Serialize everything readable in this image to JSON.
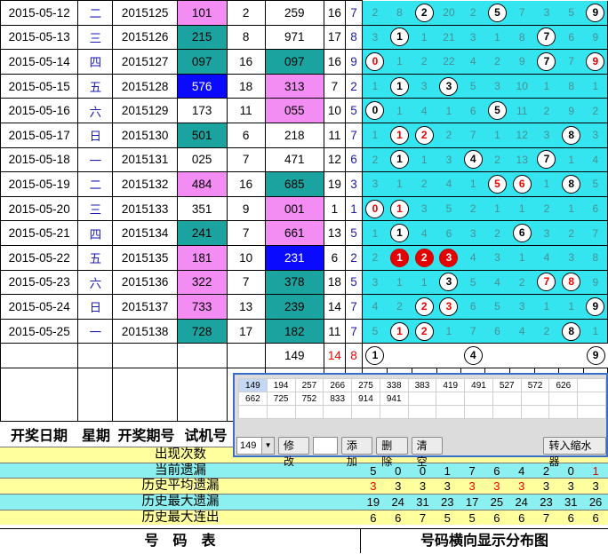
{
  "rows": [
    {
      "date": "2015-05-12",
      "week": "二",
      "issue": "2015125",
      "code": "101",
      "codeStyle": "pink",
      "sum": "2",
      "trial": "259",
      "trialStyle": "",
      "a": "16",
      "b": "7",
      "dist": [
        {
          "t": "2"
        },
        {
          "t": "8"
        },
        {
          "t": "2",
          "ball": "b"
        },
        {
          "t": "20"
        },
        {
          "t": "2"
        },
        {
          "t": "5",
          "ball": "b"
        },
        {
          "t": "7"
        },
        {
          "t": "3"
        },
        {
          "t": "5"
        },
        {
          "t": "9",
          "ball": "b"
        }
      ]
    },
    {
      "date": "2015-05-13",
      "week": "三",
      "issue": "2015126",
      "code": "215",
      "codeStyle": "teal",
      "sum": "8",
      "trial": "971",
      "trialStyle": "",
      "a": "17",
      "b": "8",
      "dist": [
        {
          "t": "3"
        },
        {
          "t": "1",
          "ball": "b"
        },
        {
          "t": "1"
        },
        {
          "t": "21"
        },
        {
          "t": "3"
        },
        {
          "t": "1"
        },
        {
          "t": "8"
        },
        {
          "t": "7",
          "ball": "b"
        },
        {
          "t": "6"
        },
        {
          "t": "9"
        }
      ]
    },
    {
      "date": "2015-05-14",
      "week": "四",
      "issue": "2015127",
      "code": "097",
      "codeStyle": "teal",
      "sum": "16",
      "trial": "097",
      "trialStyle": "teal",
      "a": "16",
      "b": "9",
      "dist": [
        {
          "t": "0",
          "ball": "r"
        },
        {
          "t": "1"
        },
        {
          "t": "2"
        },
        {
          "t": "22"
        },
        {
          "t": "4"
        },
        {
          "t": "2"
        },
        {
          "t": "9"
        },
        {
          "t": "7",
          "ball": "b"
        },
        {
          "t": "7"
        },
        {
          "t": "9",
          "ball": "r"
        }
      ]
    },
    {
      "date": "2015-05-15",
      "week": "五",
      "issue": "2015128",
      "code": "576",
      "codeStyle": "blue",
      "sum": "18",
      "trial": "313",
      "trialStyle": "pink",
      "a": "7",
      "b": "2",
      "dist": [
        {
          "t": "1"
        },
        {
          "t": "1",
          "ball": "b"
        },
        {
          "t": "3"
        },
        {
          "t": "3",
          "ball": "b"
        },
        {
          "t": "5"
        },
        {
          "t": "3"
        },
        {
          "t": "10"
        },
        {
          "t": "1"
        },
        {
          "t": "8"
        },
        {
          "t": "1"
        }
      ]
    },
    {
      "date": "2015-05-16",
      "week": "六",
      "issue": "2015129",
      "code": "173",
      "codeStyle": "",
      "sum": "11",
      "trial": "055",
      "trialStyle": "pink",
      "a": "10",
      "b": "5",
      "dist": [
        {
          "t": "0",
          "ball": "b"
        },
        {
          "t": "1"
        },
        {
          "t": "4"
        },
        {
          "t": "1"
        },
        {
          "t": "6"
        },
        {
          "t": "5",
          "ball": "b"
        },
        {
          "t": "11"
        },
        {
          "t": "2"
        },
        {
          "t": "9"
        },
        {
          "t": "2"
        }
      ]
    },
    {
      "date": "2015-05-17",
      "week": "日",
      "issue": "2015130",
      "code": "501",
      "codeStyle": "teal",
      "sum": "6",
      "trial": "218",
      "trialStyle": "",
      "a": "11",
      "b": "7",
      "dist": [
        {
          "t": "1"
        },
        {
          "t": "1",
          "ball": "r"
        },
        {
          "t": "2",
          "ball": "r"
        },
        {
          "t": "2"
        },
        {
          "t": "7"
        },
        {
          "t": "1"
        },
        {
          "t": "12"
        },
        {
          "t": "3"
        },
        {
          "t": "8",
          "ball": "b"
        },
        {
          "t": "3"
        }
      ]
    },
    {
      "date": "2015-05-18",
      "week": "一",
      "issue": "2015131",
      "code": "025",
      "codeStyle": "",
      "sum": "7",
      "trial": "471",
      "trialStyle": "",
      "a": "12",
      "b": "6",
      "dist": [
        {
          "t": "2"
        },
        {
          "t": "1",
          "ball": "b"
        },
        {
          "t": "1"
        },
        {
          "t": "3"
        },
        {
          "t": "4",
          "ball": "b"
        },
        {
          "t": "2"
        },
        {
          "t": "13"
        },
        {
          "t": "7",
          "ball": "b"
        },
        {
          "t": "1"
        },
        {
          "t": "4"
        }
      ]
    },
    {
      "date": "2015-05-19",
      "week": "二",
      "issue": "2015132",
      "code": "484",
      "codeStyle": "pink",
      "sum": "16",
      "trial": "685",
      "trialStyle": "teal",
      "a": "19",
      "b": "3",
      "dist": [
        {
          "t": "3"
        },
        {
          "t": "1"
        },
        {
          "t": "2"
        },
        {
          "t": "4"
        },
        {
          "t": "1"
        },
        {
          "t": "5",
          "ball": "r"
        },
        {
          "t": "6",
          "ball": "r"
        },
        {
          "t": "1"
        },
        {
          "t": "8",
          "ball": "b"
        },
        {
          "t": "5"
        }
      ]
    },
    {
      "date": "2015-05-20",
      "week": "三",
      "issue": "2015133",
      "code": "351",
      "codeStyle": "",
      "sum": "9",
      "trial": "001",
      "trialStyle": "pink",
      "a": "1",
      "b": "1",
      "dist": [
        {
          "t": "0",
          "ball": "r"
        },
        {
          "t": "1",
          "ball": "r"
        },
        {
          "t": "3"
        },
        {
          "t": "5"
        },
        {
          "t": "2"
        },
        {
          "t": "1"
        },
        {
          "t": "1"
        },
        {
          "t": "2"
        },
        {
          "t": "1"
        },
        {
          "t": "6"
        }
      ]
    },
    {
      "date": "2015-05-21",
      "week": "四",
      "issue": "2015134",
      "code": "241",
      "codeStyle": "teal",
      "sum": "7",
      "trial": "661",
      "trialStyle": "pink",
      "a": "13",
      "b": "5",
      "dist": [
        {
          "t": "1"
        },
        {
          "t": "1",
          "ball": "b"
        },
        {
          "t": "4"
        },
        {
          "t": "6"
        },
        {
          "t": "3"
        },
        {
          "t": "2"
        },
        {
          "t": "6",
          "ball": "b"
        },
        {
          "t": "3"
        },
        {
          "t": "2"
        },
        {
          "t": "7"
        }
      ]
    },
    {
      "date": "2015-05-22",
      "week": "五",
      "issue": "2015135",
      "code": "181",
      "codeStyle": "pink",
      "sum": "10",
      "trial": "231",
      "trialStyle": "blue",
      "a": "6",
      "b": "2",
      "dist": [
        {
          "t": "2"
        },
        {
          "t": "1",
          "ball": "f"
        },
        {
          "t": "2",
          "ball": "f"
        },
        {
          "t": "3",
          "ball": "f"
        },
        {
          "t": "4"
        },
        {
          "t": "3"
        },
        {
          "t": "1"
        },
        {
          "t": "4"
        },
        {
          "t": "3"
        },
        {
          "t": "8"
        }
      ]
    },
    {
      "date": "2015-05-23",
      "week": "六",
      "issue": "2015136",
      "code": "322",
      "codeStyle": "pink",
      "sum": "7",
      "trial": "378",
      "trialStyle": "teal",
      "a": "18",
      "b": "5",
      "dist": [
        {
          "t": "3"
        },
        {
          "t": "1"
        },
        {
          "t": "1"
        },
        {
          "t": "3",
          "ball": "b"
        },
        {
          "t": "5"
        },
        {
          "t": "4"
        },
        {
          "t": "2"
        },
        {
          "t": "7",
          "ball": "r"
        },
        {
          "t": "8",
          "ball": "r"
        },
        {
          "t": "9"
        }
      ]
    },
    {
      "date": "2015-05-24",
      "week": "日",
      "issue": "2015137",
      "code": "733",
      "codeStyle": "pink",
      "sum": "13",
      "trial": "239",
      "trialStyle": "teal",
      "a": "14",
      "b": "7",
      "dist": [
        {
          "t": "4"
        },
        {
          "t": "2"
        },
        {
          "t": "2",
          "ball": "r"
        },
        {
          "t": "3",
          "ball": "r"
        },
        {
          "t": "6"
        },
        {
          "t": "5"
        },
        {
          "t": "3"
        },
        {
          "t": "1"
        },
        {
          "t": "1"
        },
        {
          "t": "9",
          "ball": "b"
        }
      ]
    },
    {
      "date": "2015-05-25",
      "week": "一",
      "issue": "2015138",
      "code": "728",
      "codeStyle": "teal",
      "sum": "17",
      "trial": "182",
      "trialStyle": "teal",
      "a": "11",
      "b": "7",
      "dist": [
        {
          "t": "5"
        },
        {
          "t": "1",
          "ball": "r"
        },
        {
          "t": "2",
          "ball": "r"
        },
        {
          "t": "1"
        },
        {
          "t": "7"
        },
        {
          "t": "6"
        },
        {
          "t": "4"
        },
        {
          "t": "2"
        },
        {
          "t": "8",
          "ball": "b"
        },
        {
          "t": "1"
        }
      ]
    }
  ],
  "pending": {
    "trial": "149",
    "a": "14",
    "b": "8",
    "balls": [
      "1",
      "",
      "",
      "",
      "4",
      "",
      "",
      "",
      "",
      "9"
    ]
  },
  "headers": {
    "date": "开奖日期",
    "week": "星期",
    "issue": "开奖期号",
    "trial": "试机号"
  },
  "stats": [
    {
      "label": "出现次数",
      "values": [],
      "style": "yl"
    },
    {
      "label": "当前遗漏",
      "values": [
        "5",
        "0",
        "0",
        "1",
        "7",
        "6",
        "4",
        "2",
        "0",
        "1"
      ],
      "style": "cy",
      "red": [
        9
      ]
    },
    {
      "label": "历史平均遗漏",
      "values": [
        "3",
        "3",
        "3",
        "3",
        "3",
        "3",
        "3",
        "3",
        "3",
        "3"
      ],
      "style": "yl",
      "red": [
        0,
        4,
        5,
        6
      ]
    },
    {
      "label": "历史最大遗漏",
      "values": [
        "19",
        "24",
        "31",
        "23",
        "17",
        "25",
        "24",
        "23",
        "31",
        "26"
      ],
      "style": "cy",
      "red": []
    },
    {
      "label": "历史最大连出",
      "values": [
        "6",
        "6",
        "7",
        "5",
        "5",
        "6",
        "6",
        "7",
        "6",
        "6"
      ],
      "style": "yl",
      "red": []
    }
  ],
  "footer": {
    "left": "号　码　表",
    "right": "号码横向显示分布图"
  },
  "dialog": {
    "grid": [
      [
        "149",
        "194",
        "257",
        "266",
        "275",
        "338",
        "383",
        "419",
        "491",
        "527",
        "572",
        "626"
      ],
      [
        "662",
        "725",
        "752",
        "833",
        "914",
        "941",
        "",
        "",
        "",
        "",
        "",
        ""
      ]
    ],
    "combo": "149",
    "modify": "修改",
    "add": "添加",
    "delete": "删除",
    "clear": "清空",
    "transfer": "转入缩水器"
  }
}
